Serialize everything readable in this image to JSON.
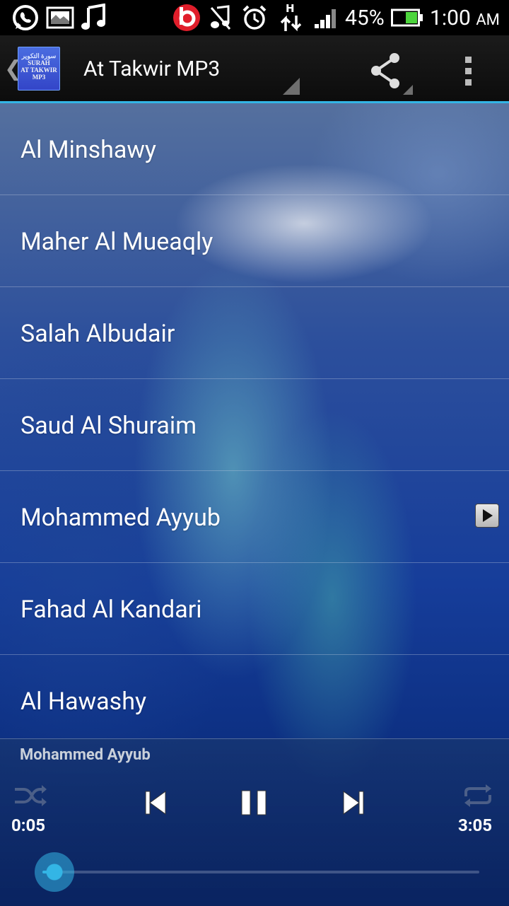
{
  "status_bar": {
    "battery_percent": "45%",
    "time": "1:00",
    "time_suffix": "AM",
    "icons": [
      "whatsapp-icon",
      "gallery-icon",
      "music-note-icon",
      "beats-icon",
      "mute-icon",
      "alarm-icon",
      "data-transfer-icon",
      "signal-icon",
      "battery-icon"
    ]
  },
  "action_bar": {
    "title": "At Takwir MP3",
    "app_icon_text": {
      "arabic": "سورة التكوير",
      "line1": "SURAH",
      "line2": "AT TAKWIR",
      "line3": "MP3"
    }
  },
  "reciters": [
    {
      "label": "Al Minshawy"
    },
    {
      "label": "Maher Al Mueaqly"
    },
    {
      "label": "Salah Albudair"
    },
    {
      "label": "Saud Al Shuraim"
    },
    {
      "label": "Mohammed Ayyub",
      "playing": true
    },
    {
      "label": "Fahad Al Kandari"
    },
    {
      "label": "Al Hawashy"
    }
  ],
  "player": {
    "now_playing": "Mohammed Ayyub",
    "time_current": "0:05",
    "time_total": "3:05",
    "progress_fraction": 0.027
  },
  "colors": {
    "accent": "#33b5e5"
  }
}
